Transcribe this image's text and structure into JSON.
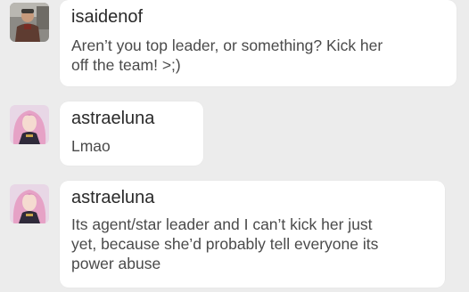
{
  "messages": [
    {
      "username": "isaidenof",
      "avatar": "avatar-man-icon",
      "lines": [
        "Aren’t you top leader, or something? Kick her",
        "off the team! >;)"
      ]
    },
    {
      "username": "astraeluna",
      "avatar": "avatar-pink-hair-icon",
      "lines": [
        "Lmao"
      ]
    },
    {
      "username": "astraeluna",
      "avatar": "avatar-pink-hair-icon",
      "lines": [
        "Its agent/star leader and I can’t kick her just",
        "yet, because she’d probably tell everyone its",
        "power abuse"
      ]
    }
  ],
  "colors": {
    "background": "#ececec",
    "bubble": "#ffffff",
    "username": "#2a2a2a",
    "text": "#4a4a4a"
  }
}
